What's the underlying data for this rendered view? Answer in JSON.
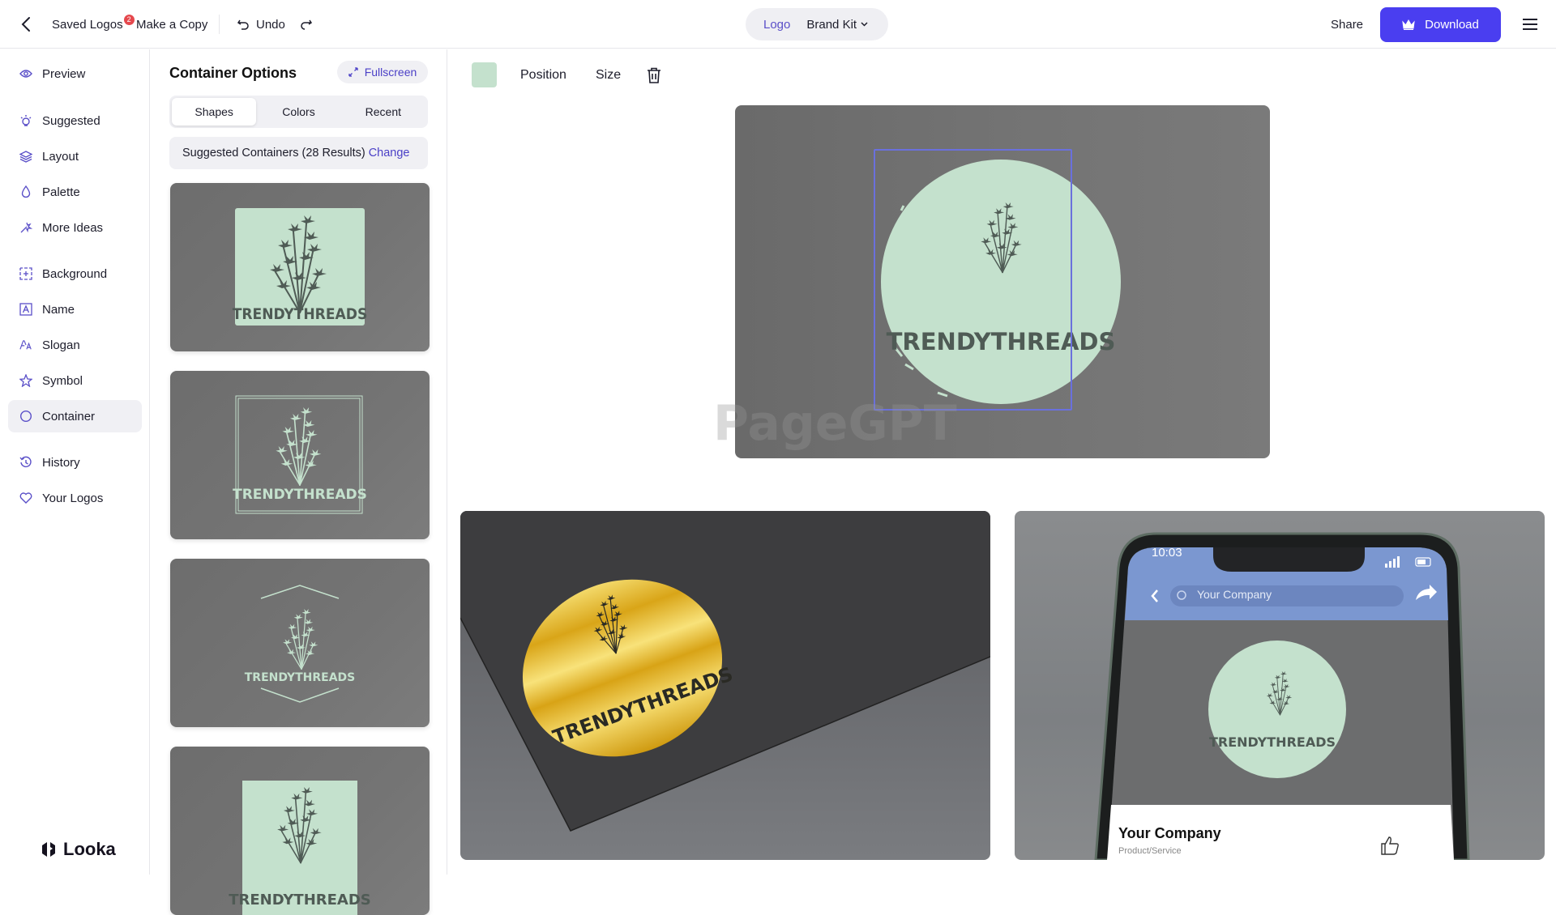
{
  "topbar": {
    "back_icon": "chevron-left-icon",
    "saved_logos_label": "Saved Logos",
    "saved_logos_count": "2",
    "make_copy_label": "Make a Copy",
    "undo_label": "Undo",
    "redo_icon": "redo-icon",
    "mode_switch": {
      "logo_label": "Logo",
      "brand_kit_label": "Brand Kit"
    },
    "share_label": "Share",
    "download_label": "Download",
    "menu_icon": "hamburger-menu-icon"
  },
  "sidebar": {
    "items": [
      {
        "label": "Preview",
        "icon": "eye-icon"
      },
      {
        "label": "Suggested",
        "icon": "lightbulb-icon"
      },
      {
        "label": "Layout",
        "icon": "layers-icon"
      },
      {
        "label": "Palette",
        "icon": "droplet-icon"
      },
      {
        "label": "More Ideas",
        "icon": "magic-wand-icon"
      },
      {
        "label": "Background",
        "icon": "background-grid-icon"
      },
      {
        "label": "Name",
        "icon": "text-box-icon"
      },
      {
        "label": "Slogan",
        "icon": "font-size-icon"
      },
      {
        "label": "Symbol",
        "icon": "star-icon"
      },
      {
        "label": "Container",
        "icon": "circle-icon",
        "active": true
      },
      {
        "label": "History",
        "icon": "history-icon"
      },
      {
        "label": "Your Logos",
        "icon": "heart-icon"
      }
    ],
    "brand_name": "Looka"
  },
  "panel": {
    "title": "Container Options",
    "fullscreen_label": "Fullscreen",
    "tabs": [
      {
        "label": "Shapes",
        "active": true
      },
      {
        "label": "Colors"
      },
      {
        "label": "Recent"
      }
    ],
    "suggested_text": "Suggested Containers (28 Results)",
    "change_label": "Change",
    "thumbnails": [
      {
        "style": "filled-rectangle",
        "logo_text": "TRENDYTHREADS"
      },
      {
        "style": "outlined-double-rectangle",
        "logo_text": "TRENDYTHREADS"
      },
      {
        "style": "hexagon-lines",
        "logo_text": "TRENDYTHREADS"
      },
      {
        "style": "filled-tall-rectangle",
        "logo_text": "TRENDYTHREADS"
      }
    ]
  },
  "editor": {
    "swatch_color": "#c4e1cd",
    "position_label": "Position",
    "size_label": "Size",
    "delete_icon": "trash-icon",
    "logo_text": "TRENDYTHREADS",
    "container_color": "#c4e1cd",
    "ink_color": "#4f5b55",
    "selection_color": "#6a70dd"
  },
  "mockups": {
    "sticker": {
      "logo_text": "TRENDYTHREADS"
    },
    "phone": {
      "time": "10:03",
      "search_text": "Your Company",
      "logo_text": "TRENDYTHREADS",
      "company_name": "Your Company",
      "company_category": "Product/Service"
    }
  },
  "watermark": "PageGPT",
  "colors": {
    "accent": "#4a3ef0",
    "link": "#4b40c7",
    "badge": "#e5484d"
  }
}
